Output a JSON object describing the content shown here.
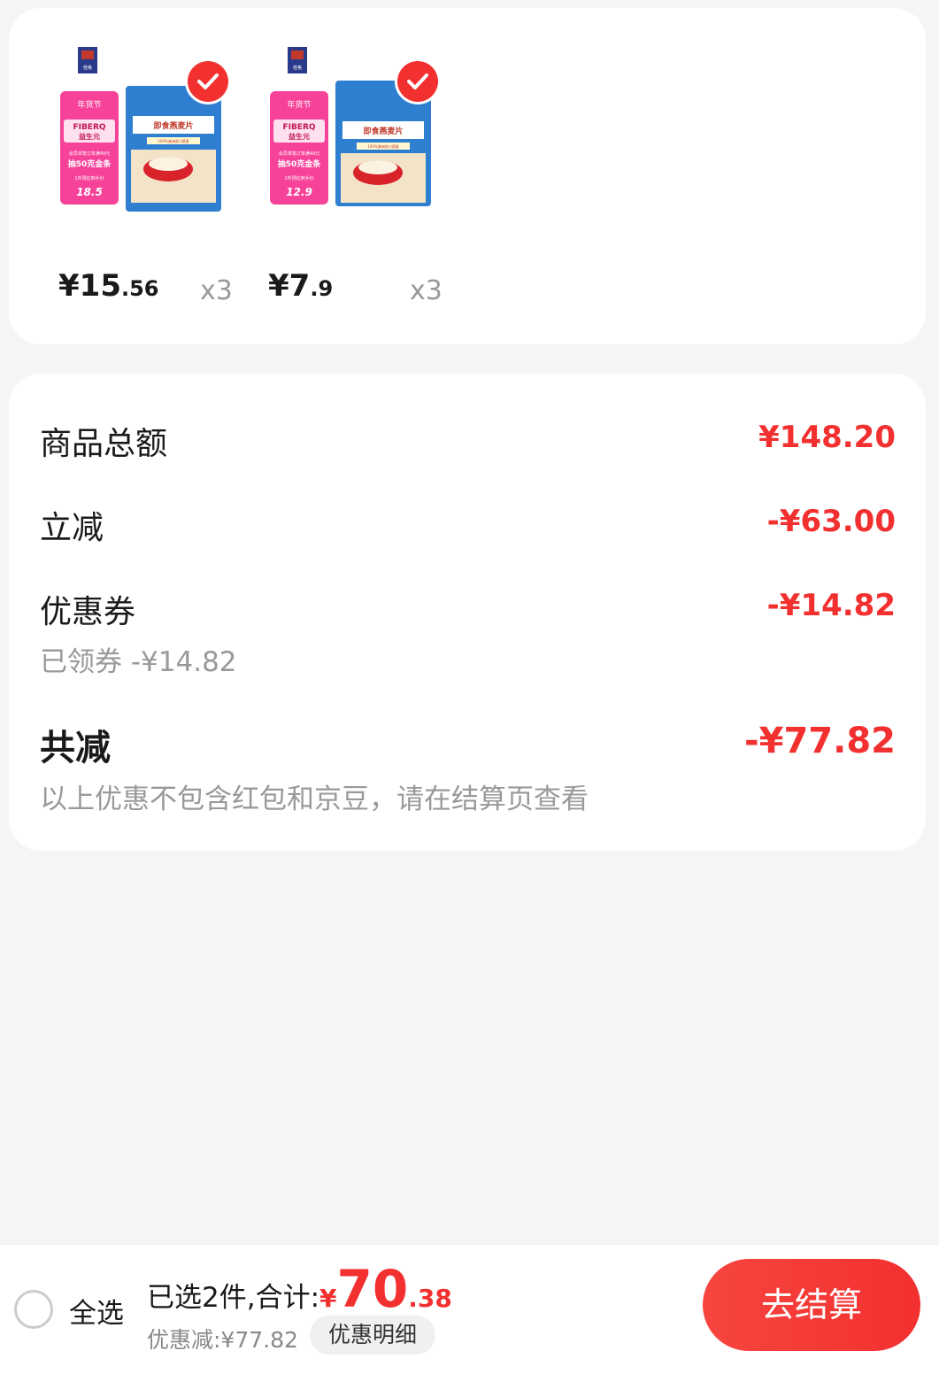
{
  "products": [
    {
      "price_main": "¥15",
      "price_decimal": ".56",
      "quantity": "x3",
      "img_text": {
        "festival": "年货节",
        "badge": "FIBERQ",
        "badge_cn": "益生元",
        "promo_line": "会员单笔订单满49元",
        "promo_main": "抽50克金条",
        "price_note": "1件预估到手价",
        "price_val": "18.5",
        "pack_title": "即食燕麦片",
        "pack_sub": "100%澳洲进口燕麦",
        "brand": "桂格"
      }
    },
    {
      "price_main": "¥7",
      "price_decimal": ".9",
      "quantity": "x3",
      "img_text": {
        "festival": "年货节",
        "badge": "FIBERQ",
        "badge_cn": "益生元",
        "promo_line": "会员单笔订单满49元",
        "promo_main": "抽50克金条",
        "price_note": "1件预估到手价",
        "price_val": "12.9",
        "pack_title": "即食燕麦片",
        "pack_sub": "100%澳洲进口燕麦",
        "brand": "桂格"
      }
    }
  ],
  "summary": {
    "goods_total_label": "商品总额",
    "goods_total_value": "¥148.20",
    "instant_discount_label": "立减",
    "instant_discount_value": "-¥63.00",
    "coupon_label": "优惠券",
    "coupon_value": "-¥14.82",
    "coupon_sub": "已领券 -¥14.82",
    "total_discount_label": "共减",
    "total_discount_value": "-¥77.82",
    "note": "以上优惠不包含红包和京豆，请在结算页查看"
  },
  "bottom_bar": {
    "select_all_label": "全选",
    "selected_prefix": "已选2件,合计:",
    "currency": "¥",
    "total_integer": "70",
    "total_decimal": ".38",
    "discount_text": "优惠减:¥77.82",
    "detail_button": "优惠明细",
    "checkout_button": "去结算"
  },
  "colors": {
    "accent": "#f2302f",
    "background": "#f5f5f5",
    "card": "#ffffff",
    "muted": "#999999"
  }
}
